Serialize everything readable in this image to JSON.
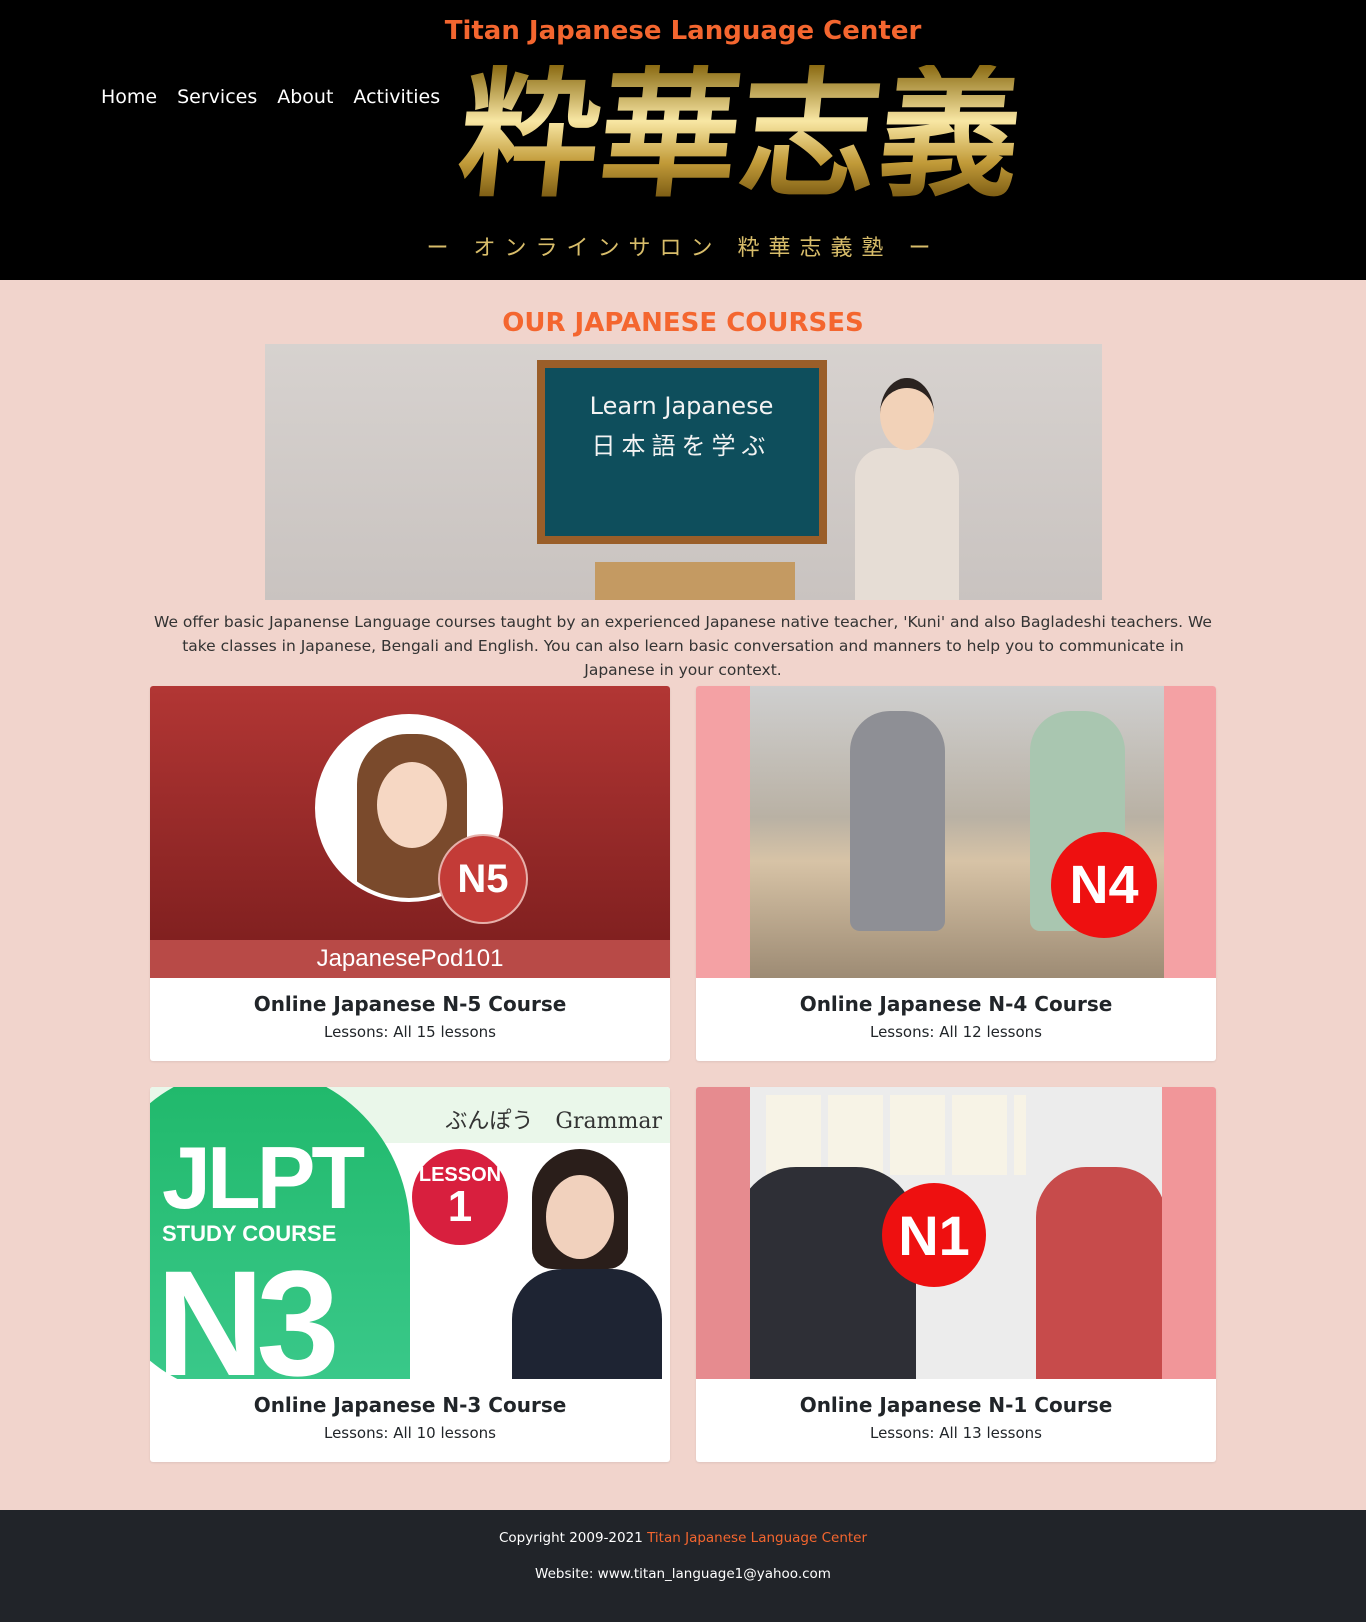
{
  "header": {
    "site_title": "Titan Japanese Language Center",
    "nav": [
      "Home",
      "Services",
      "About",
      "Activities"
    ],
    "logo_kanji": [
      "粋",
      "華",
      "志",
      "義"
    ],
    "logo_subtitle": "ー オンラインサロン 粋華志義塾 ー",
    "colors": {
      "background": "#000000",
      "accent": "#f4662f",
      "gold": "#d8bd6a"
    }
  },
  "main": {
    "section_title": "OUR JAPANESE COURSES",
    "banner": {
      "board_line1": "Learn Japanese",
      "board_line2": "日本語を学ぶ"
    },
    "intro": "We offer basic Japanense Language courses taught by an experienced Japanese native teacher, 'Kuni' and also Bagladeshi teachers. We take classes in Japanese, Bengali and English. You can also learn basic conversation and manners to help you to communicate in Japanese in your context.",
    "background_color": "#f1d4cc",
    "courses": [
      {
        "title": "Online Japanese N-5 Course",
        "lessons": "Lessons: All 15 lessons",
        "image_badge": "N5",
        "image_caption": "JapanesePod101"
      },
      {
        "title": "Online Japanese N-4 Course",
        "lessons": "Lessons: All 12 lessons",
        "image_badge": "N4"
      },
      {
        "title": "Online Japanese N-3 Course",
        "lessons": "Lessons: All 10 lessons",
        "image_top_text": "ぶんぽう　Grammar",
        "image_jlpt": "JLPT",
        "image_study": "STUDY COURSE",
        "image_level": "N3",
        "image_lesson_label": "LESSON",
        "image_lesson_number": "1"
      },
      {
        "title": "Online Japanese N-1 Course",
        "lessons": "Lessons: All 13 lessons",
        "image_badge": "N1"
      }
    ]
  },
  "footer": {
    "copyright_prefix": "Copyright 2009-2021 ",
    "copyright_name": "Titan Japanese Language Center",
    "website": "Website: www.titan_language1@yahoo.com",
    "background_color": "#212429"
  }
}
